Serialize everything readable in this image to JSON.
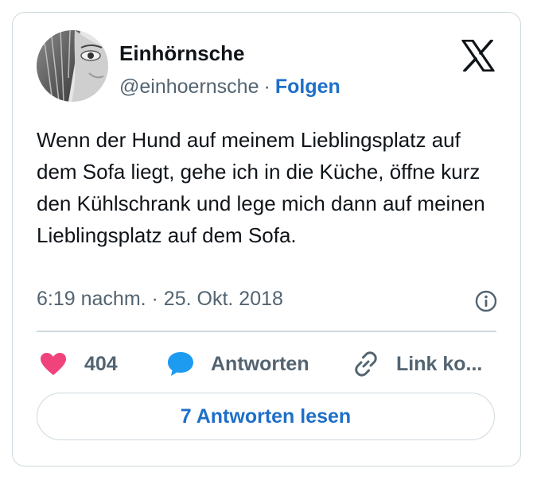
{
  "author": {
    "name": "Einhörnsche",
    "handle": "@einhoernsche",
    "separator": "·",
    "follow_label": "Folgen"
  },
  "tweet": {
    "text": "Wenn der Hund auf meinem Lieblingsplatz auf dem Sofa liegt, gehe ich in die Küche, öffne kurz den Kühlschrank und lege mich dann auf meinen Lieblingsplatz auf dem Sofa.",
    "timestamp": "6:19 nachm. · 25. Okt. 2018"
  },
  "actions": {
    "like_count": "404",
    "reply_label": "Antworten",
    "link_label": "Link ko..."
  },
  "read_replies_label": "7 Antworten lesen",
  "icons": {
    "like": "heart-icon",
    "reply": "speech-bubble-icon",
    "link": "link-icon",
    "info": "info-icon",
    "brand": "x-logo-icon"
  },
  "colors": {
    "heart": "#f0437b",
    "reply_bubble": "#1d9bf0",
    "link_blue": "#1d6fc9",
    "muted_text": "#536471",
    "border": "#cfd9de"
  }
}
